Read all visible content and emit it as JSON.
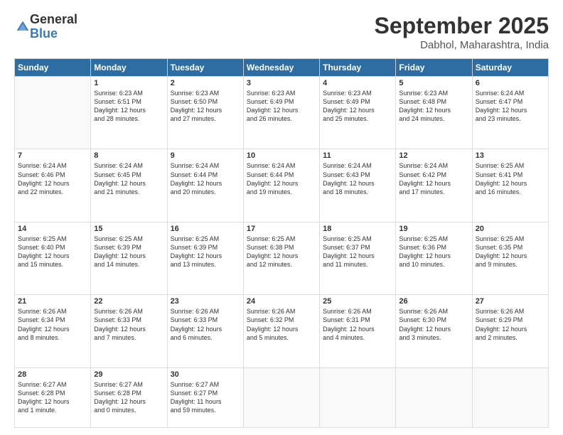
{
  "logo": {
    "general": "General",
    "blue": "Blue"
  },
  "header": {
    "month": "September 2025",
    "location": "Dabhol, Maharashtra, India"
  },
  "weekdays": [
    "Sunday",
    "Monday",
    "Tuesday",
    "Wednesday",
    "Thursday",
    "Friday",
    "Saturday"
  ],
  "weeks": [
    [
      {
        "day": "",
        "content": ""
      },
      {
        "day": "1",
        "content": "Sunrise: 6:23 AM\nSunset: 6:51 PM\nDaylight: 12 hours\nand 28 minutes."
      },
      {
        "day": "2",
        "content": "Sunrise: 6:23 AM\nSunset: 6:50 PM\nDaylight: 12 hours\nand 27 minutes."
      },
      {
        "day": "3",
        "content": "Sunrise: 6:23 AM\nSunset: 6:49 PM\nDaylight: 12 hours\nand 26 minutes."
      },
      {
        "day": "4",
        "content": "Sunrise: 6:23 AM\nSunset: 6:49 PM\nDaylight: 12 hours\nand 25 minutes."
      },
      {
        "day": "5",
        "content": "Sunrise: 6:23 AM\nSunset: 6:48 PM\nDaylight: 12 hours\nand 24 minutes."
      },
      {
        "day": "6",
        "content": "Sunrise: 6:24 AM\nSunset: 6:47 PM\nDaylight: 12 hours\nand 23 minutes."
      }
    ],
    [
      {
        "day": "7",
        "content": "Sunrise: 6:24 AM\nSunset: 6:46 PM\nDaylight: 12 hours\nand 22 minutes."
      },
      {
        "day": "8",
        "content": "Sunrise: 6:24 AM\nSunset: 6:45 PM\nDaylight: 12 hours\nand 21 minutes."
      },
      {
        "day": "9",
        "content": "Sunrise: 6:24 AM\nSunset: 6:44 PM\nDaylight: 12 hours\nand 20 minutes."
      },
      {
        "day": "10",
        "content": "Sunrise: 6:24 AM\nSunset: 6:44 PM\nDaylight: 12 hours\nand 19 minutes."
      },
      {
        "day": "11",
        "content": "Sunrise: 6:24 AM\nSunset: 6:43 PM\nDaylight: 12 hours\nand 18 minutes."
      },
      {
        "day": "12",
        "content": "Sunrise: 6:24 AM\nSunset: 6:42 PM\nDaylight: 12 hours\nand 17 minutes."
      },
      {
        "day": "13",
        "content": "Sunrise: 6:25 AM\nSunset: 6:41 PM\nDaylight: 12 hours\nand 16 minutes."
      }
    ],
    [
      {
        "day": "14",
        "content": "Sunrise: 6:25 AM\nSunset: 6:40 PM\nDaylight: 12 hours\nand 15 minutes."
      },
      {
        "day": "15",
        "content": "Sunrise: 6:25 AM\nSunset: 6:39 PM\nDaylight: 12 hours\nand 14 minutes."
      },
      {
        "day": "16",
        "content": "Sunrise: 6:25 AM\nSunset: 6:39 PM\nDaylight: 12 hours\nand 13 minutes."
      },
      {
        "day": "17",
        "content": "Sunrise: 6:25 AM\nSunset: 6:38 PM\nDaylight: 12 hours\nand 12 minutes."
      },
      {
        "day": "18",
        "content": "Sunrise: 6:25 AM\nSunset: 6:37 PM\nDaylight: 12 hours\nand 11 minutes."
      },
      {
        "day": "19",
        "content": "Sunrise: 6:25 AM\nSunset: 6:36 PM\nDaylight: 12 hours\nand 10 minutes."
      },
      {
        "day": "20",
        "content": "Sunrise: 6:25 AM\nSunset: 6:35 PM\nDaylight: 12 hours\nand 9 minutes."
      }
    ],
    [
      {
        "day": "21",
        "content": "Sunrise: 6:26 AM\nSunset: 6:34 PM\nDaylight: 12 hours\nand 8 minutes."
      },
      {
        "day": "22",
        "content": "Sunrise: 6:26 AM\nSunset: 6:33 PM\nDaylight: 12 hours\nand 7 minutes."
      },
      {
        "day": "23",
        "content": "Sunrise: 6:26 AM\nSunset: 6:33 PM\nDaylight: 12 hours\nand 6 minutes."
      },
      {
        "day": "24",
        "content": "Sunrise: 6:26 AM\nSunset: 6:32 PM\nDaylight: 12 hours\nand 5 minutes."
      },
      {
        "day": "25",
        "content": "Sunrise: 6:26 AM\nSunset: 6:31 PM\nDaylight: 12 hours\nand 4 minutes."
      },
      {
        "day": "26",
        "content": "Sunrise: 6:26 AM\nSunset: 6:30 PM\nDaylight: 12 hours\nand 3 minutes."
      },
      {
        "day": "27",
        "content": "Sunrise: 6:26 AM\nSunset: 6:29 PM\nDaylight: 12 hours\nand 2 minutes."
      }
    ],
    [
      {
        "day": "28",
        "content": "Sunrise: 6:27 AM\nSunset: 6:28 PM\nDaylight: 12 hours\nand 1 minute."
      },
      {
        "day": "29",
        "content": "Sunrise: 6:27 AM\nSunset: 6:28 PM\nDaylight: 12 hours\nand 0 minutes."
      },
      {
        "day": "30",
        "content": "Sunrise: 6:27 AM\nSunset: 6:27 PM\nDaylight: 11 hours\nand 59 minutes."
      },
      {
        "day": "",
        "content": ""
      },
      {
        "day": "",
        "content": ""
      },
      {
        "day": "",
        "content": ""
      },
      {
        "day": "",
        "content": ""
      }
    ]
  ]
}
